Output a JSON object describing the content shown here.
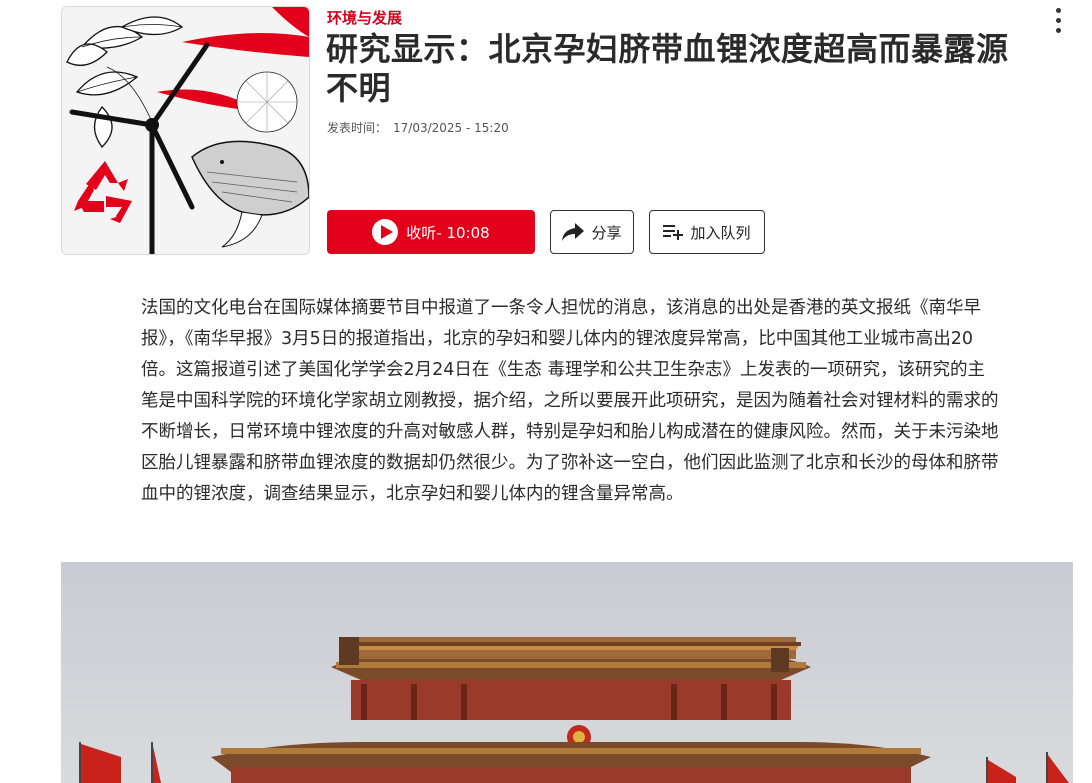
{
  "article": {
    "category": "环境与发展",
    "title": "研究显示：北京孕妇脐带血锂浓度超高而暴露源不明",
    "published_label": "发表时间：",
    "published_value": "17/03/2025 - 15:20",
    "body": "法国的文化电台在国际媒体摘要节目中报道了一条令人担忧的消息，该消息的出处是香港的英文报纸《南华早报》，《南华早报》3月5日的报道指出，北京的孕妇和婴儿体内的锂浓度异常高，比中国其他工业城市高出20倍。这篇报道引述了美国化学学会2月24日在《生态 毒理学和公共卫生杂志》上发表的一项研究，该研究的主笔是中国科学院的环境化学家胡立刚教授，据介绍，之所以要展开此项研究，是因为随着社会对锂材料的需求的不断增长，日常环境中锂浓度的升高对敏感人群，特别是孕妇和胎儿构成潜在的健康风险。然而，关于未污染地区胎儿锂暴露和脐带血锂浓度的数据却仍然很少。为了弥补这一空白，他们因此监测了北京和长沙的母体和脐带血中的锂浓度，调查结果显示，北京孕妇和婴儿体内的锂含量异常高。"
  },
  "actions": {
    "listen_label": "收听- 10:08",
    "share_label": "分享",
    "queue_label": "加入队列"
  },
  "icons": {
    "menu": "more-vertical-icon",
    "play": "play-icon",
    "share": "share-arrow-icon",
    "queue": "playlist-add-icon",
    "recycle": "recycle-icon"
  },
  "colors": {
    "accent": "#e2001a",
    "category": "#d6001c",
    "title": "#2a2a2a"
  }
}
